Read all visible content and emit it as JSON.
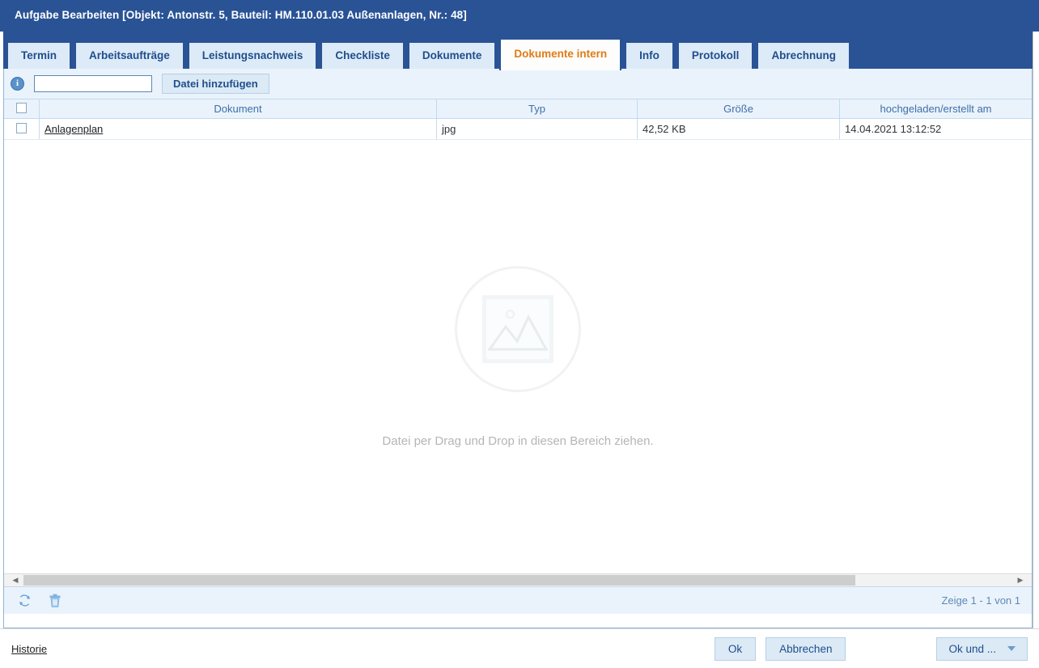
{
  "window": {
    "title": "Aufgabe Bearbeiten [Objekt: Antonstr. 5, Bauteil: HM.110.01.03 Außenanlagen, Nr.: 48]",
    "titlebar_color": "#2a5396",
    "accent_active_tab_color": "#e07b16"
  },
  "tabs": [
    {
      "label": "Termin",
      "active": false
    },
    {
      "label": "Arbeitsaufträge",
      "active": false
    },
    {
      "label": "Leistungsnachweis",
      "active": false
    },
    {
      "label": "Checkliste",
      "active": false
    },
    {
      "label": "Dokumente",
      "active": false
    },
    {
      "label": "Dokumente intern",
      "active": true
    },
    {
      "label": "Info",
      "active": false
    },
    {
      "label": "Protokoll",
      "active": false
    },
    {
      "label": "Abrechnung",
      "active": false
    }
  ],
  "toolbar": {
    "info_icon": "info-icon",
    "info_glyph": "i",
    "file_input_value": "",
    "file_input_placeholder": "",
    "add_file_label": "Datei hinzufügen"
  },
  "grid": {
    "columns": [
      "Dokument",
      "Typ",
      "Größe",
      "hochgeladen/erstellt am"
    ],
    "select_all_checked": false,
    "rows": [
      {
        "checked": false,
        "document": "Anlagenplan",
        "typ": "jpg",
        "groesse": "42,52 KB",
        "datum": "14.04.2021 13:12:52"
      }
    ]
  },
  "dropzone": {
    "placeholder_icon": "image-placeholder-icon",
    "text": "Datei per Drag und Drop in diesen Bereich ziehen."
  },
  "scrollbar": {
    "left_arrow": "◀",
    "right_arrow": "▶"
  },
  "statusbar": {
    "refresh_icon": "refresh-icon",
    "delete_icon": "trash-icon",
    "count_text": "Zeige 1 - 1 von 1"
  },
  "footer": {
    "history_label": "Historie",
    "ok_label": "Ok",
    "cancel_label": "Abbrechen",
    "ok_and_label": "Ok und ...",
    "dropdown_icon": "chevron-down-icon"
  }
}
